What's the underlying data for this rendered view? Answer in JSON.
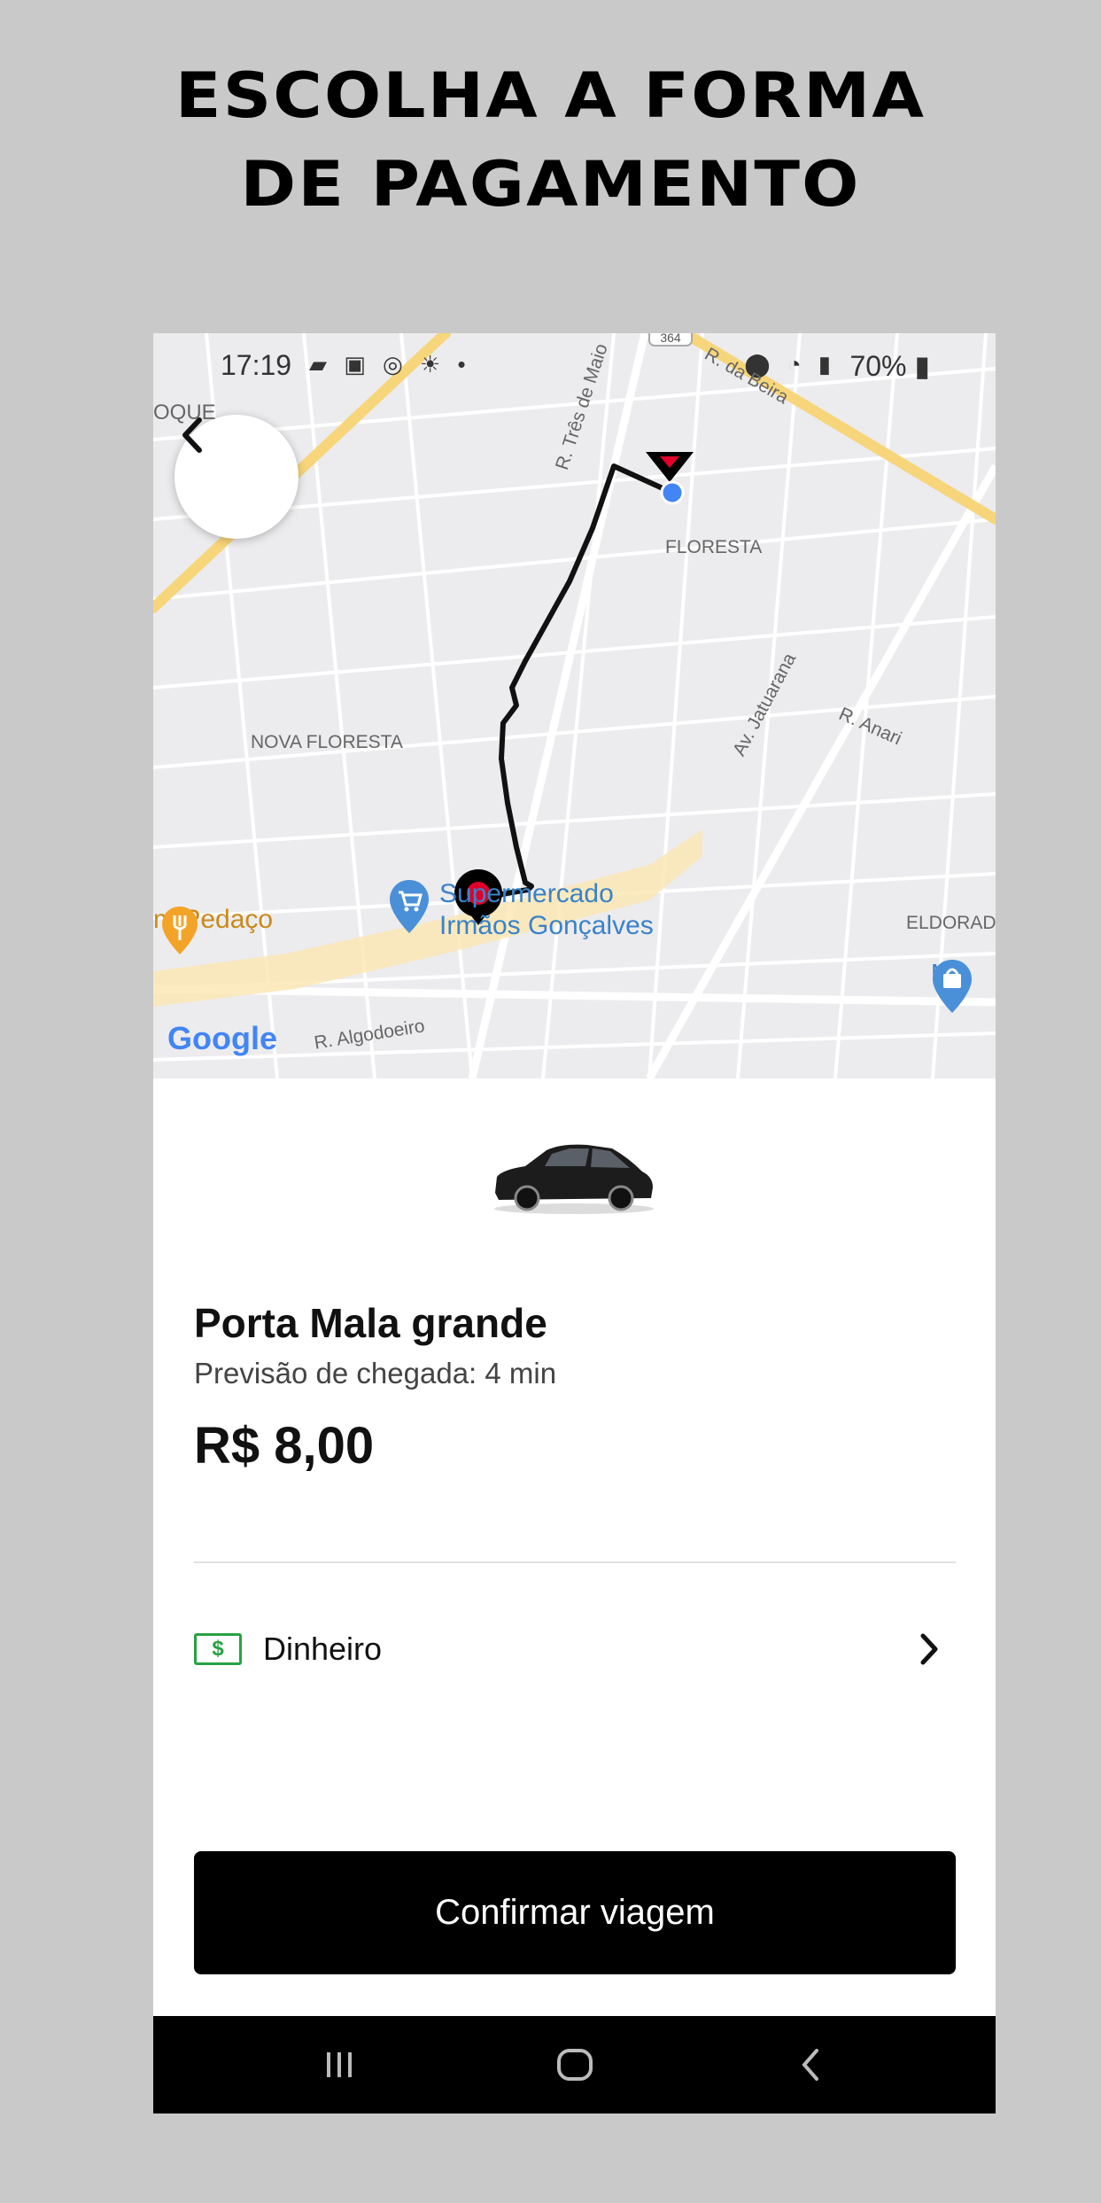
{
  "headline": {
    "line1": "ESCOLHA A FORMA",
    "line2": "DE PAGAMENTO"
  },
  "status_bar": {
    "time": "17:19",
    "left_icons": [
      "message-icon",
      "voicemail-icon",
      "instagram-icon",
      "weather-icon",
      "dot"
    ],
    "right_icons": [
      "location-icon",
      "wifi-icon",
      "signal-icon"
    ],
    "battery": "70%"
  },
  "map": {
    "labels": {
      "oque": "OQUE",
      "floresta": "FLORESTA",
      "nova_floresta": "NOVA FLORESTA",
      "eldorado": "ELDORADO",
      "street_tres_maio": "R. Três de Maio",
      "street_beira": "R. da Beira",
      "street_jatuarana": "Av. Jatuarana",
      "street_anari": "R. Anari",
      "street_algodoeiro": "R. Algodoeiro",
      "route_badge": "364"
    },
    "pois": {
      "restaurant": "m Pedaço",
      "supermarket_line1": "Supermercado",
      "supermarket_line2": "Irmãos Gonçalves",
      "store": "M s"
    },
    "google": "Google"
  },
  "ride": {
    "name": "Porta Mala grande",
    "eta": "Previsão de chegada: 4 min",
    "price": "R$ 8,00"
  },
  "payment": {
    "icon_text": "$",
    "label": "Dinheiro"
  },
  "confirm_label": "Confirmar viagem",
  "colors": {
    "background": "#c9c9c9",
    "accent_green": "#27a244",
    "route_pin_red": "#e0002a",
    "origin_blue": "#4285f4",
    "button": "#000000"
  }
}
